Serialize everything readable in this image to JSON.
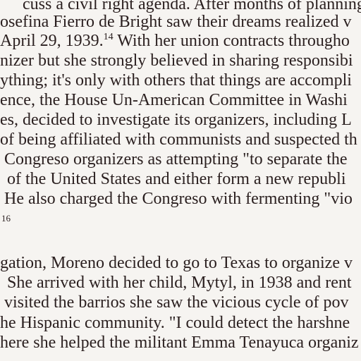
{
  "document": {
    "paragraph1": [
      "cuss a civil right agenda. After months of planning a",
      "osefina Fierro de Bright saw their dreams realized v",
      "April 29, 1939.",
      "nizer but she strongly believed in sharing responsibi",
      "ything; it's only with others that things are accompli",
      "ence, the House Un-American Committee in Washi",
      "es, decided to investigate its organizers, including L",
      "of being affiliated with communists and suspected th",
      "Congreso organizers as attempting \"to separate the",
      "of the United States and either form a new republi",
      "He also charged the Congreso with fermenting \"vio"
    ],
    "line3_footnote": "14",
    "line3_rest": " With her union contracts througho",
    "footnote_marker": "16",
    "paragraph2": [
      "gation, Moreno decided to go to Texas to organize v",
      "She arrived with her child, Mytyl, in 1938 and rent",
      "visited the barrios she saw the vicious cycle of pov",
      "he Hispanic community. \"I could detect the harshne",
      "here she helped the militant Emma Tenayuca organiz"
    ]
  }
}
